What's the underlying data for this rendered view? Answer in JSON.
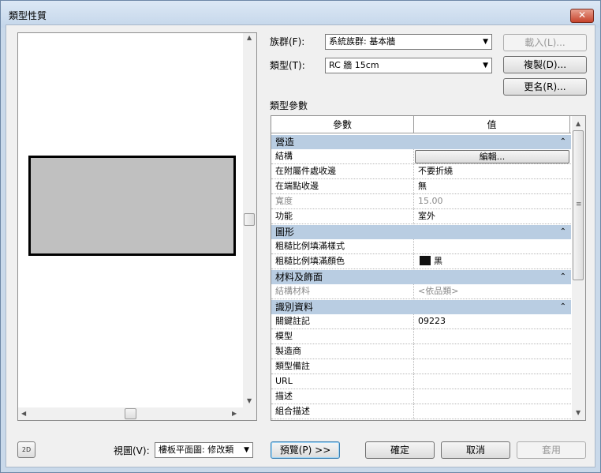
{
  "window": {
    "title": "類型性質",
    "close_glyph": "✕"
  },
  "family": {
    "label": "族群(F):",
    "value": "系統族群: 基本牆"
  },
  "type": {
    "label": "類型(T):",
    "value": "RC 牆 15cm"
  },
  "buttons": {
    "load": "載入(L)...",
    "duplicate": "複製(D)...",
    "rename": "更名(R)...",
    "preview": "預覽(P) >>",
    "ok": "確定",
    "cancel": "取消",
    "apply": "套用"
  },
  "type_params_label": "類型參數",
  "table": {
    "col_param": "參數",
    "col_value": "值",
    "groups": [
      {
        "name": "營造",
        "rows": [
          {
            "param": "結構",
            "value": "編輯...",
            "kind": "button"
          },
          {
            "param": "在附屬件處收邊",
            "value": "不要折繞"
          },
          {
            "param": "在端點收邊",
            "value": "無"
          },
          {
            "param": "寬度",
            "value": "15.00",
            "kind": "grey"
          },
          {
            "param": "功能",
            "value": "室外"
          }
        ]
      },
      {
        "name": "圖形",
        "rows": [
          {
            "param": "粗糙比例填滿樣式",
            "value": ""
          },
          {
            "param": "粗糙比例填滿顏色",
            "value": "黑",
            "kind": "swatch"
          }
        ]
      },
      {
        "name": "材料及飾面",
        "rows": [
          {
            "param": "結構材料",
            "value": "<依品類>",
            "kind": "grey"
          }
        ]
      },
      {
        "name": "識別資料",
        "rows": [
          {
            "param": "關鍵註記",
            "value": "09223"
          },
          {
            "param": "模型",
            "value": ""
          },
          {
            "param": "製造商",
            "value": ""
          },
          {
            "param": "類型備註",
            "value": ""
          },
          {
            "param": "URL",
            "value": ""
          },
          {
            "param": "描述",
            "value": ""
          },
          {
            "param": "組合描述",
            "value": ""
          }
        ]
      }
    ]
  },
  "view": {
    "label": "視圖(V):",
    "value": "樓板平面圖: 修改類"
  },
  "view2d_icon_text": "2D",
  "colors": {
    "group_header": "#b9cde2",
    "titlebar": "#c4d6ea",
    "close": "#c7432b"
  }
}
